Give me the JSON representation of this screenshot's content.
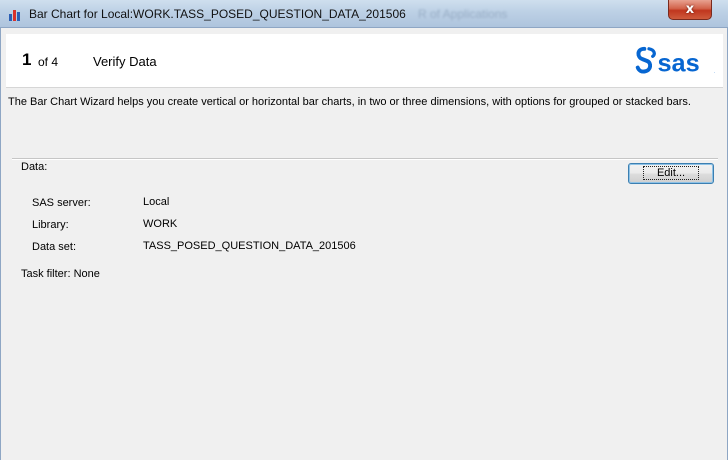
{
  "window": {
    "title": "Bar Chart for Local:WORK.TASS_POSED_QUESTION_DATA_201506",
    "ghost_title": "R of Applications",
    "close_glyph": "x",
    "icon": "bar-chart-icon"
  },
  "header": {
    "step_number": "1",
    "step_of": "of 4",
    "step_name": "Verify Data",
    "logo": "sas-logo"
  },
  "description": "The Bar Chart Wizard helps you create vertical or horizontal bar charts, in two or three dimensions, with options for grouped or stacked bars.",
  "data_section": {
    "label": "Data:",
    "edit_button": "Edit...",
    "rows": [
      {
        "label": "SAS server:",
        "value": "Local"
      },
      {
        "label": "Library:",
        "value": "WORK"
      },
      {
        "label": "Data set:",
        "value": "TASS_POSED_QUESTION_DATA_201506"
      }
    ],
    "task_filter": "Task filter: None"
  },
  "colors": {
    "titlebar": "#bcd0e5",
    "close_button": "#c0361e",
    "sas_blue": "#0766d1",
    "edit_border": "#3c7fb1"
  }
}
